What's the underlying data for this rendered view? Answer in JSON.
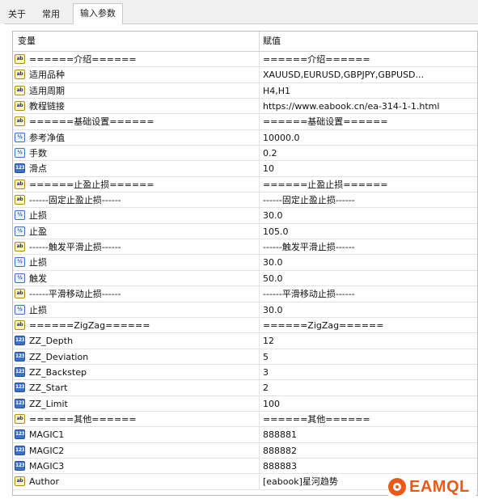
{
  "tabs": [
    {
      "label": "关于",
      "active": false
    },
    {
      "label": "常用",
      "active": false
    },
    {
      "label": "输入参数",
      "active": true
    }
  ],
  "table": {
    "header": {
      "variable": "变量",
      "value": "赋值"
    },
    "rows": [
      {
        "icon": "ab",
        "name": "======介绍======",
        "value": "======介绍======"
      },
      {
        "icon": "ab",
        "name": "适用品种",
        "value": "XAUUSD,EURUSD,GBPJPY,GBPUSD..."
      },
      {
        "icon": "ab",
        "name": "适用周期",
        "value": "H4,H1"
      },
      {
        "icon": "ab",
        "name": "教程链接",
        "value": "https://www.eabook.cn/ea-314-1-1.html"
      },
      {
        "icon": "ab",
        "name": "======基础设置======",
        "value": "======基础设置======"
      },
      {
        "icon": "dbl",
        "name": "参考净值",
        "value": "10000.0"
      },
      {
        "icon": "dbl",
        "name": "手数",
        "value": "0.2"
      },
      {
        "icon": "num",
        "name": "滑点",
        "value": "10"
      },
      {
        "icon": "ab",
        "name": "======止盈止损======",
        "value": "======止盈止损======"
      },
      {
        "icon": "ab",
        "name": "------固定止盈止损------",
        "value": "------固定止盈止损------"
      },
      {
        "icon": "dbl",
        "name": "止损",
        "value": "30.0"
      },
      {
        "icon": "dbl",
        "name": "止盈",
        "value": "105.0"
      },
      {
        "icon": "ab",
        "name": "------触发平滑止损------",
        "value": "------触发平滑止损------"
      },
      {
        "icon": "dbl",
        "name": "止损",
        "value": "30.0"
      },
      {
        "icon": "dbl",
        "name": "触发",
        "value": "50.0"
      },
      {
        "icon": "ab",
        "name": "------平滑移动止损------",
        "value": "------平滑移动止损------"
      },
      {
        "icon": "dbl",
        "name": "止损",
        "value": "30.0"
      },
      {
        "icon": "ab",
        "name": "======ZigZag======",
        "value": "======ZigZag======"
      },
      {
        "icon": "num",
        "name": "ZZ_Depth",
        "value": "12"
      },
      {
        "icon": "num",
        "name": "ZZ_Deviation",
        "value": "5"
      },
      {
        "icon": "num",
        "name": "ZZ_Backstep",
        "value": "3"
      },
      {
        "icon": "num",
        "name": "ZZ_Start",
        "value": "2"
      },
      {
        "icon": "num",
        "name": "ZZ_Limit",
        "value": "100"
      },
      {
        "icon": "ab",
        "name": "======其他======",
        "value": "======其他======"
      },
      {
        "icon": "num",
        "name": "MAGIC1",
        "value": "888881"
      },
      {
        "icon": "num",
        "name": "MAGIC2",
        "value": "888882"
      },
      {
        "icon": "num",
        "name": "MAGIC3",
        "value": "888883"
      },
      {
        "icon": "ab",
        "name": "Author",
        "value": "[eabook]星河趋势"
      }
    ]
  },
  "icons": {
    "ab": {
      "name": "string-param-icon",
      "glyph": "ab"
    },
    "num": {
      "name": "integer-param-icon",
      "glyph": "123"
    },
    "dbl": {
      "name": "double-param-icon",
      "glyph": "½"
    }
  },
  "watermark": {
    "text": "EAMQL"
  },
  "colors": {
    "accent": "#e8591a",
    "icon_blue": "#3b72c4"
  }
}
